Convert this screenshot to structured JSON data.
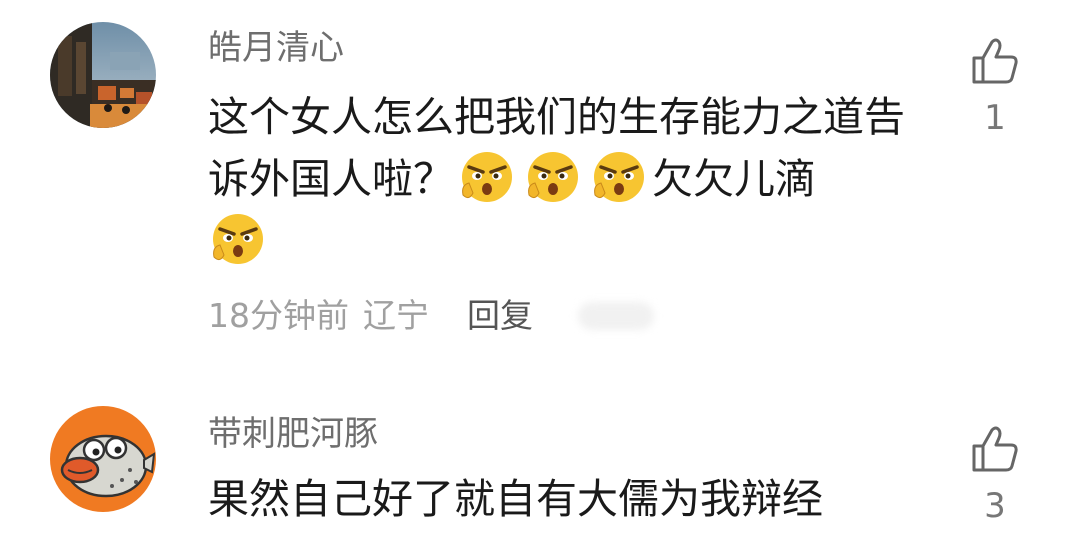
{
  "comments": [
    {
      "username": "皓月清心",
      "text_part1": "这个女人怎么把我们的生存能力之道告诉外国人啦？",
      "text_part2": "欠欠儿滴",
      "emoji_icon": "smug-face-emoji",
      "time": "18分钟前",
      "location": "辽宁",
      "reply_label": "回复",
      "like_count": "1"
    },
    {
      "username": "带刺肥河豚",
      "text_part1": "果然自己好了就自有大儒为我辩经",
      "like_count": "3"
    }
  ],
  "colors": {
    "username": "#6e6e6e",
    "text": "#1a1a1a",
    "meta": "#a0a0a0",
    "reply": "#555555",
    "avatar2_bg": "#f07a22",
    "emoji_yellow": "#f7c531"
  }
}
